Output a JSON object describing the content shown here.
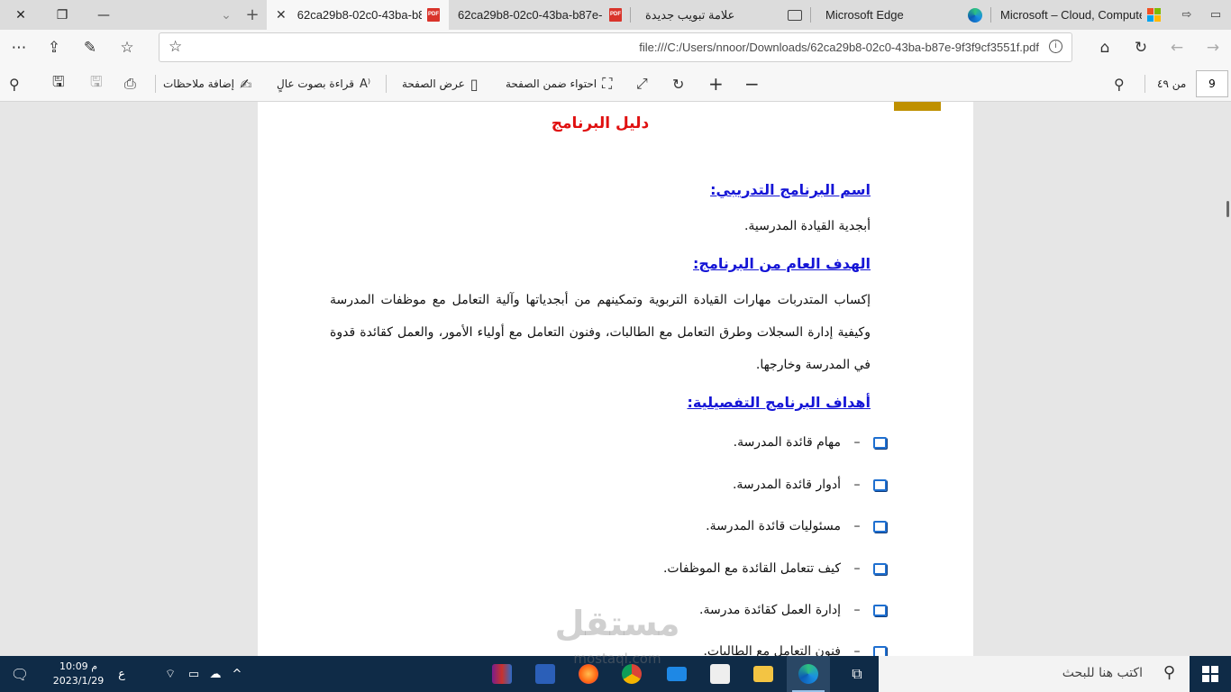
{
  "tabs": [
    {
      "label": "Microsoft – Cloud, Compute",
      "icon": "microsoft-logo-icon"
    },
    {
      "label": "Microsoft Edge",
      "icon": "edge-icon"
    },
    {
      "label": "علامة تبويب جديدة",
      "icon": "new-tab-icon"
    },
    {
      "label": "62ca29b8-02c0-43ba-b87e-",
      "icon": "pdf-icon"
    },
    {
      "label": "62ca29b8-02c0-43ba-b8",
      "icon": "pdf-icon",
      "active": true
    }
  ],
  "pdf_badge": "PDF",
  "address": {
    "url": "file:///C:/Users/nnoor/Downloads/62ca29b8-02c0-43ba-b87e-9f3f9cf3551f.pdf"
  },
  "toolbar": {
    "page_current": "9",
    "page_total": "من ٤٩",
    "fit_page": "احتواء ضمن الصفحة",
    "page_view": "عرض الصفحة",
    "read_aloud": "قراءة بصوت عالٍ",
    "add_notes": "إضافة ملاحظات"
  },
  "document": {
    "title": "دليل البرنامج",
    "program_name_heading": "اسم البرنامج التدريبي:",
    "program_name": "أبجدية القيادة المدرسية.",
    "goal_heading": "الهدف العام من البرنامج:",
    "goal_text": "إكساب المتدربات مهارات القيادة التربوية وتمكينهم من أبجدياتها وآلية التعامل مع موظفات المدرسة وكيفية إدارة السجلات وطرق التعامل مع الطالبات، وفنون التعامل مع أولياء الأمور، والعمل كقائدة قدوة في المدرسة وخارجها.",
    "objectives_heading": "أهداف البرنامج التفصيلية:",
    "objectives": [
      "مهام قائدة المدرسة.",
      "أدوار قائدة المدرسة.",
      "مسئوليات قائدة المدرسة.",
      "كيف تتعامل القائدة مع الموظفات.",
      "إدارة العمل كقائدة مدرسة.",
      "فنون التعامل مع الطالبات."
    ]
  },
  "watermark": {
    "main": "مستقل",
    "sub": "mostaql.com"
  },
  "taskbar": {
    "search_placeholder": "اكتب هنا للبحث",
    "time": "10:09 م",
    "date": "2023/1/29",
    "lang": "ع"
  },
  "colors": {
    "title_red": "#e01010",
    "heading_blue": "#1515d6",
    "checkbox_blue": "#1e6fd0",
    "corner_gold": "#bf9000",
    "taskbar_bg": "#0f2b47"
  }
}
